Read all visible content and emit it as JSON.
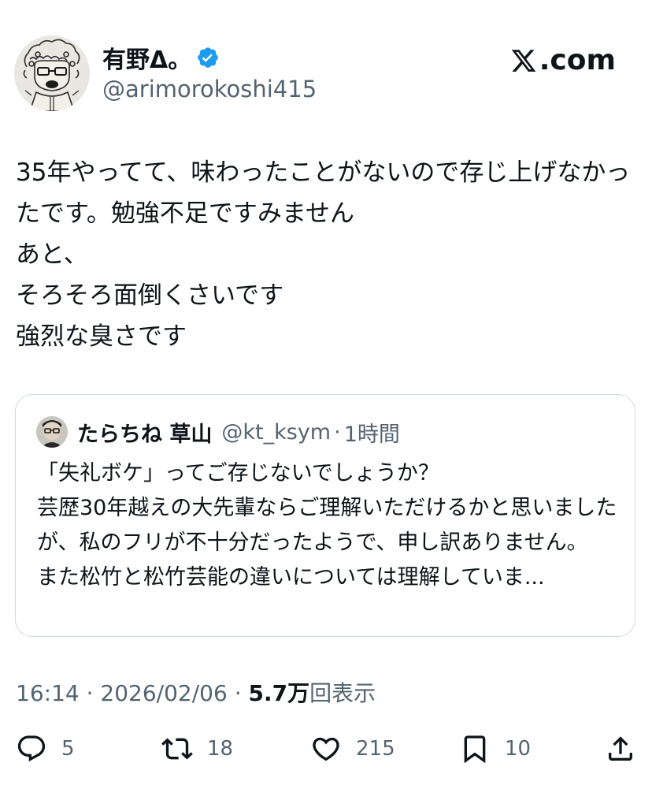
{
  "author": {
    "display_name": "有野Δ。",
    "handle": "@arimorokoshi415",
    "verified": true
  },
  "site": {
    "domain": "com",
    "logo_icon": "x-logo-icon"
  },
  "tweet": {
    "text": "35年やってて、味わったことがないので存じ上げなかったです。勉強不足ですみません\nあと、\nそろそろ面倒くさいです\n強烈な臭さです"
  },
  "quote": {
    "display_name": "たらちね 草山",
    "handle": "@kt_ksym",
    "separator": "·",
    "time": "1時間",
    "text": "「失礼ボケ」ってご存じないでしょうか？\n芸歴30年越えの大先輩ならご理解いただけるかと思いましたが、私のフリが不十分だったようで、申し訳ありません。\nまた松竹と松竹芸能の違いについては理解していま..."
  },
  "meta": {
    "time": "16:14",
    "sep1": "·",
    "date": "2026/02/06",
    "sep2": "·",
    "views_count": "5.7万",
    "views_label": "回表示"
  },
  "actions": {
    "replies": "5",
    "reposts": "18",
    "likes": "215",
    "bookmarks": "10"
  },
  "colors": {
    "text": "#0f1419",
    "secondary": "#536471",
    "border": "#cfd9de",
    "verified_blue": "#1d9bf0"
  }
}
